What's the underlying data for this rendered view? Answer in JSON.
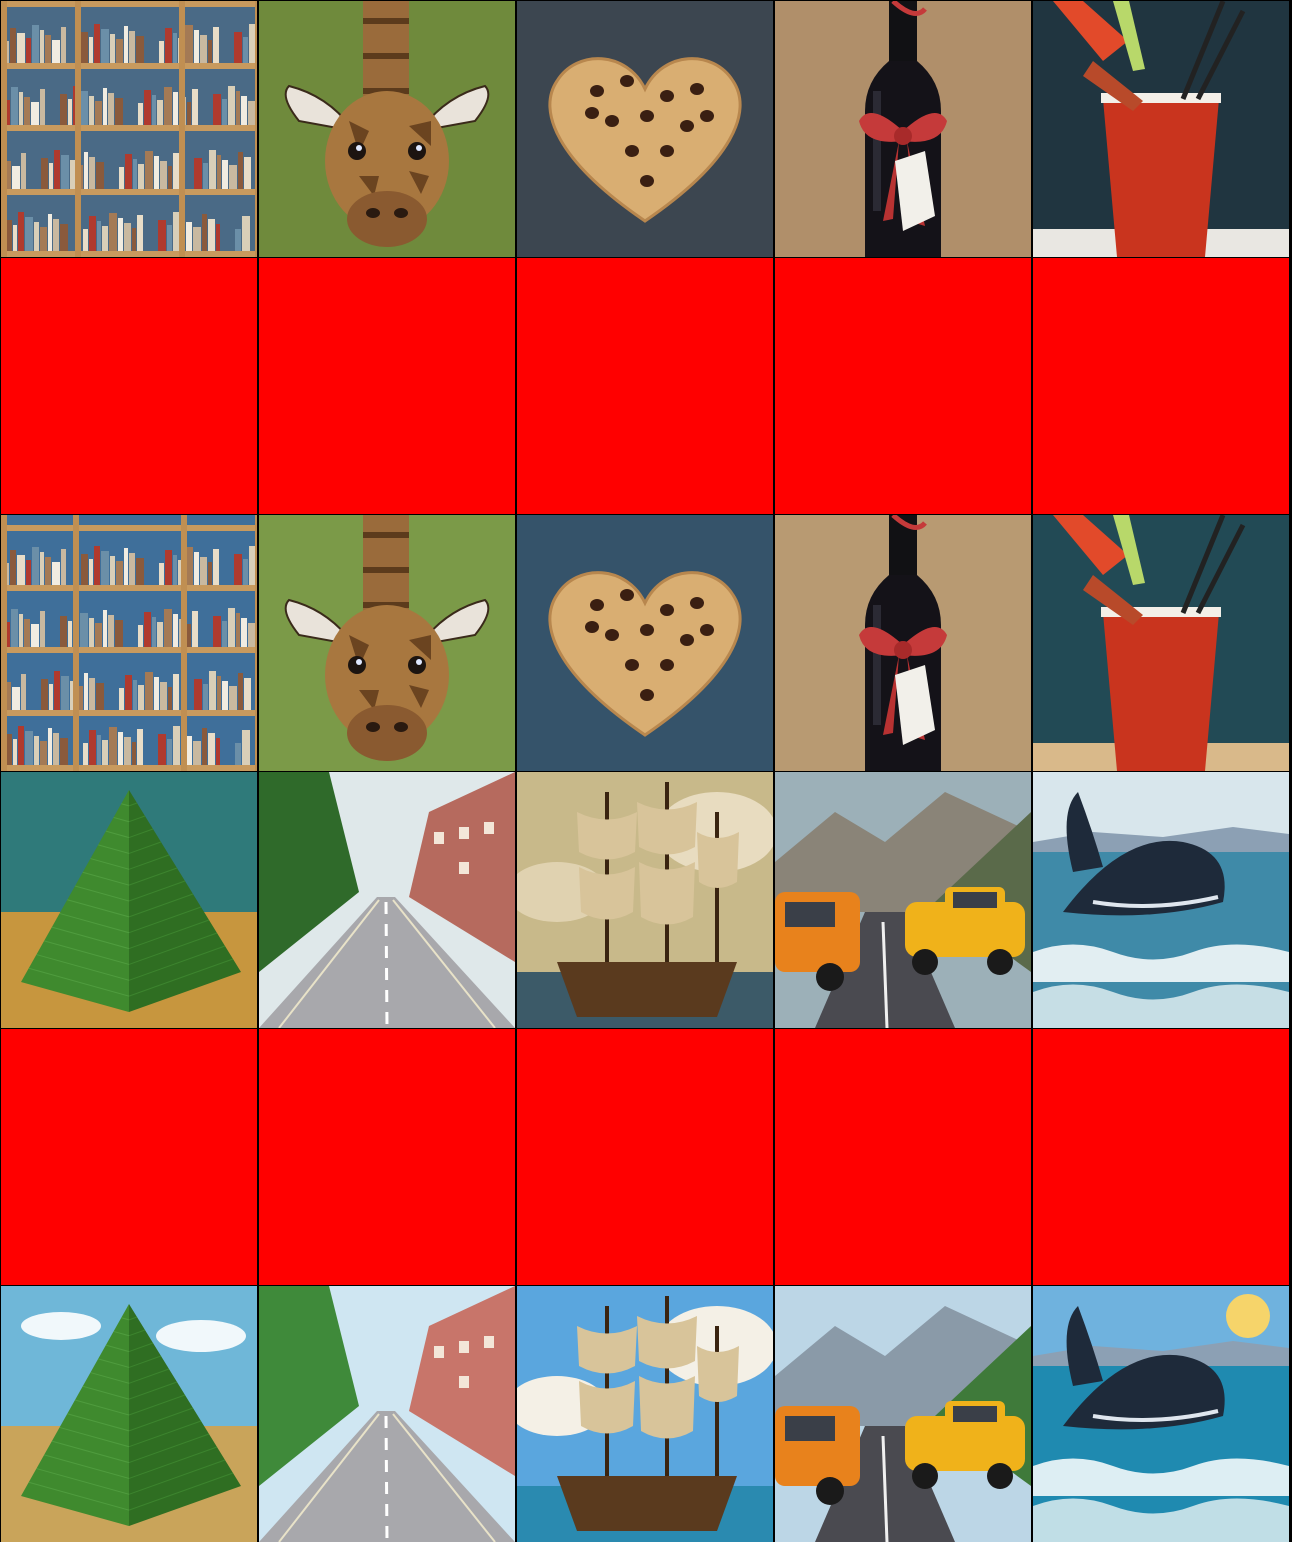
{
  "grid": {
    "columns": 5,
    "rows": 6,
    "placeholder_color": "#ff0000",
    "background_color": "#000000"
  },
  "rows": [
    {
      "kind": "images",
      "style": "render-a",
      "tiles": [
        {
          "subject": "bookshelf"
        },
        {
          "subject": "giraffe"
        },
        {
          "subject": "heart-cookie"
        },
        {
          "subject": "wine-bottle-bow"
        },
        {
          "subject": "bloody-mary"
        }
      ]
    },
    {
      "kind": "placeholder",
      "tiles": [
        {},
        {},
        {},
        {},
        {}
      ]
    },
    {
      "kind": "images",
      "style": "render-b",
      "tiles": [
        {
          "subject": "bookshelf"
        },
        {
          "subject": "giraffe"
        },
        {
          "subject": "heart-cookie"
        },
        {
          "subject": "wine-bottle-bow"
        },
        {
          "subject": "bloody-mary"
        }
      ]
    },
    {
      "kind": "images",
      "style": "render-a",
      "tiles": [
        {
          "subject": "green-pyramid"
        },
        {
          "subject": "city-street"
        },
        {
          "subject": "sailing-ship"
        },
        {
          "subject": "cars-on-road"
        },
        {
          "subject": "breaching-whale"
        }
      ]
    },
    {
      "kind": "placeholder",
      "tiles": [
        {},
        {},
        {},
        {},
        {}
      ]
    },
    {
      "kind": "images",
      "style": "render-b",
      "tiles": [
        {
          "subject": "green-pyramid"
        },
        {
          "subject": "city-street"
        },
        {
          "subject": "sailing-ship"
        },
        {
          "subject": "cars-on-road"
        },
        {
          "subject": "breaching-whale"
        }
      ]
    }
  ]
}
